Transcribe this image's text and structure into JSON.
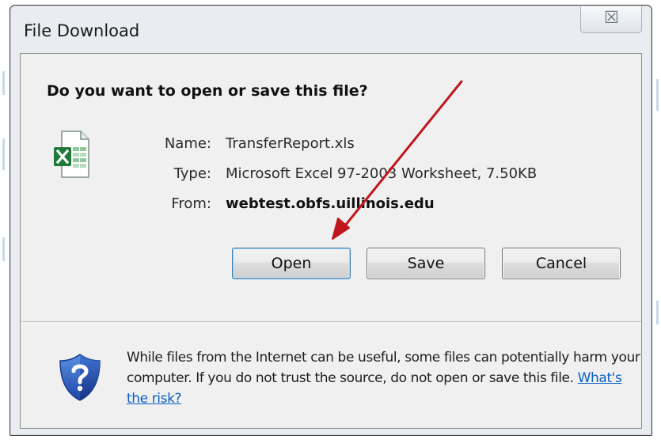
{
  "dialog": {
    "title": "File Download",
    "close_glyph": "☒",
    "question": "Do you want to open or save this file?"
  },
  "file": {
    "icon": "excel-file-icon",
    "name_label": "Name:",
    "name_value": "TransferReport.xls",
    "type_label": "Type:",
    "type_value": "Microsoft Excel 97-2003 Worksheet, 7.50KB",
    "from_label": "From:",
    "from_value": "webtest.obfs.uillinois.edu"
  },
  "buttons": {
    "open": "Open",
    "save": "Save",
    "cancel": "Cancel"
  },
  "warning": {
    "icon": "security-shield-question-icon",
    "text": "While files from the Internet can be useful, some files can potentially harm your computer. If you do not trust the source, do not open or save this file.",
    "link": "What's the risk?"
  },
  "colors": {
    "link": "#0b5fc2",
    "annotation_arrow": "#c0161e",
    "excel_green": "#1f7a3a"
  }
}
